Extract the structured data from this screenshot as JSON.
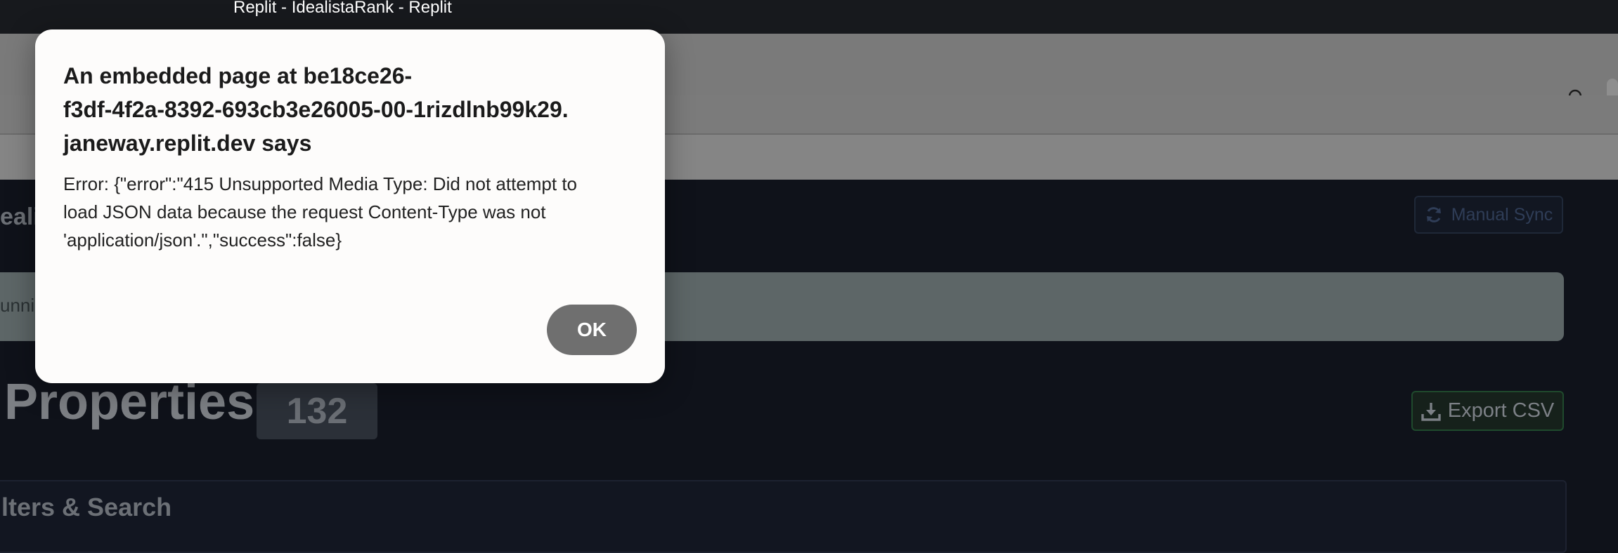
{
  "window": {
    "title": "Replit - IdealistaRank - Replit"
  },
  "app": {
    "brand_partial": "eali",
    "sync_button_label": "Manual Sync",
    "status_partial": "unni",
    "properties_title": "Properties",
    "properties_count": "132",
    "export_button_label": "Export CSV",
    "filters_title": "lters & Search"
  },
  "dialog": {
    "heading_lines": [
      "An embedded page at be18ce26-",
      "f3df-4f2a-8392-693cb3e26005-00-1rizdlnb99k29.",
      "janeway.replit.dev says"
    ],
    "message_lines": [
      "Error: {\"error\":\"415 Unsupported Media Type: Did not attempt to",
      "load JSON data because the request Content-Type was not",
      "'application/json'.\",\"success\":false}"
    ],
    "ok_label": "OK"
  },
  "icons": {
    "search": "search-icon",
    "sync": "refresh-icon",
    "export": "download-icon"
  },
  "colors": {
    "dialog_bg": "#fdfcfb",
    "ok_button": "#6f6f6f",
    "app_bg": "#0f121a"
  }
}
